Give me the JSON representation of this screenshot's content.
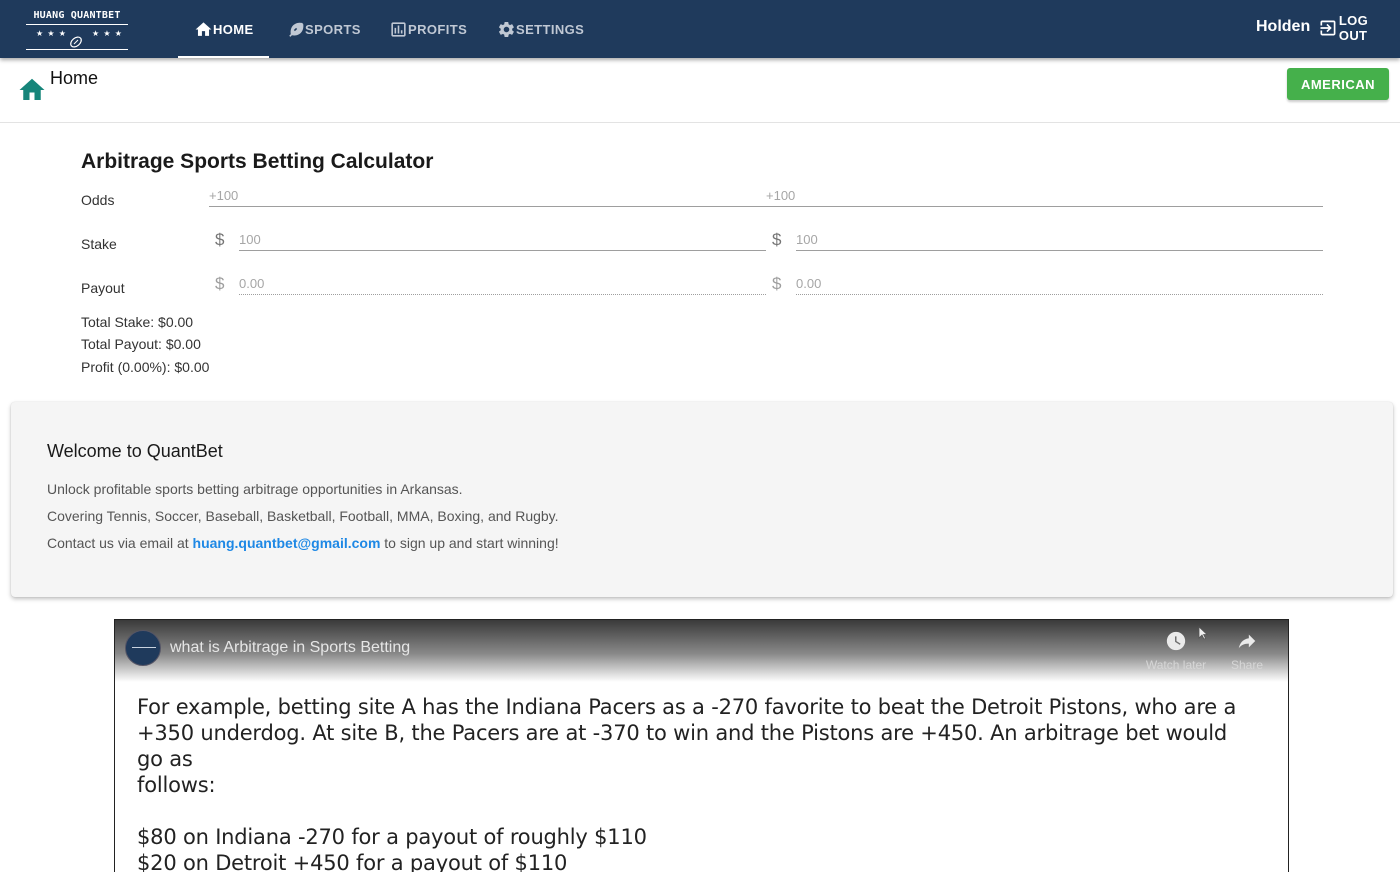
{
  "brand": {
    "name": "HUANG QUANTBET",
    "stars": "★ ★ ★"
  },
  "nav": {
    "home": "HOME",
    "sports": "SPORTS",
    "profits": "PROFITS",
    "settings": "SETTINGS"
  },
  "user": {
    "name": "Holden",
    "logout": "LOG OUT"
  },
  "header": {
    "title": "Home",
    "odds_format": "AMERICAN"
  },
  "calculator": {
    "title": "Arbitrage Sports Betting Calculator",
    "odds_label": "Odds",
    "stake_label": "Stake",
    "payout_label": "Payout",
    "currency": "$",
    "odds_1_placeholder": "+100",
    "odds_2_placeholder": "+100",
    "stake_1_placeholder": "100",
    "stake_2_placeholder": "100",
    "payout_1_placeholder": "0.00",
    "payout_2_placeholder": "0.00",
    "total_stake": "Total Stake: $0.00",
    "total_payout": "Total Payout: $0.00",
    "profit": "Profit (0.00%): $0.00"
  },
  "welcome": {
    "title": "Welcome to QuantBet",
    "line1": "Unlock profitable sports betting arbitrage opportunities in Arkansas.",
    "line2": "Covering Tennis, Soccer, Baseball, Basketball, Football, MMA, Boxing, and Rugby.",
    "line3_prefix": "Contact us via email at ",
    "email": "huang.quantbet@gmail.com",
    "line3_suffix": " to sign up and start winning!"
  },
  "video": {
    "title": "what is Arbitrage in Sports Betting",
    "watch_later": "Watch later",
    "share": "Share",
    "line1": "For example, betting site A has the Indiana Pacers as a -270 favorite to beat the Detroit Pistons, who are a",
    "line2": "+350 underdog. At site B, the Pacers are at -370 to win and the Pistons are +450. An arbitrage bet would go as",
    "line3": "follows:",
    "line4": "$80 on Indiana -270 for a payout of roughly $110",
    "line5": "$20 on Detroit +450 for a payout of $110"
  },
  "colors": {
    "navbar": "#1f3a5c",
    "accent_green": "#45b04b",
    "home_icon": "#16857a",
    "link_blue": "#1e88e5"
  }
}
